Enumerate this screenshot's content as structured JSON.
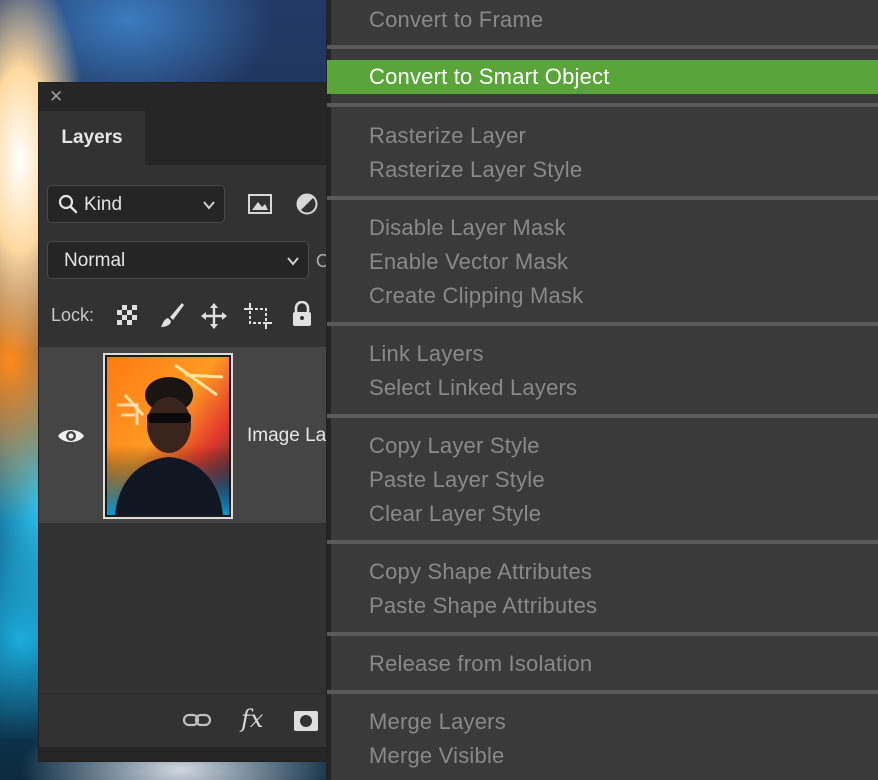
{
  "panel": {
    "close_glyph": "✕",
    "tab_label": "Layers",
    "filter": {
      "selected": "Kind",
      "icons": [
        "image-filter-icon",
        "adjustment-filter-icon"
      ]
    },
    "blend_mode": {
      "selected": "Normal"
    },
    "opacity_cut": "O",
    "lock": {
      "label": "Lock:",
      "icons": [
        "lock-transparent-pixels-icon",
        "lock-image-pixels-icon",
        "lock-position-icon",
        "lock-artboard-icon",
        "lock-all-icon"
      ]
    },
    "layers": [
      {
        "name": "Image La",
        "visible": true,
        "visibility_icon": "eye-icon"
      }
    ],
    "bottom_icons": [
      "link-layers-icon",
      "layer-style-fx-icon",
      "add-mask-icon"
    ],
    "fx_label": "fx"
  },
  "context_menu": {
    "groups": [
      {
        "items": [
          {
            "label": "Convert to Frame",
            "enabled": false
          }
        ]
      },
      {
        "items": [
          {
            "label": "Convert to Smart Object",
            "enabled": true,
            "highlighted": true
          }
        ]
      },
      {
        "items": [
          {
            "label": "Rasterize Layer",
            "enabled": false
          },
          {
            "label": "Rasterize Layer Style",
            "enabled": false
          }
        ]
      },
      {
        "items": [
          {
            "label": "Disable Layer Mask",
            "enabled": false
          },
          {
            "label": "Enable Vector Mask",
            "enabled": false
          },
          {
            "label": "Create Clipping Mask",
            "enabled": false
          }
        ]
      },
      {
        "items": [
          {
            "label": "Link Layers",
            "enabled": false
          },
          {
            "label": "Select Linked Layers",
            "enabled": false
          }
        ]
      },
      {
        "items": [
          {
            "label": "Copy Layer Style",
            "enabled": false
          },
          {
            "label": "Paste Layer Style",
            "enabled": false
          },
          {
            "label": "Clear Layer Style",
            "enabled": false
          }
        ]
      },
      {
        "items": [
          {
            "label": "Copy Shape Attributes",
            "enabled": false
          },
          {
            "label": "Paste Shape Attributes",
            "enabled": false
          }
        ]
      },
      {
        "items": [
          {
            "label": "Release from Isolation",
            "enabled": false
          }
        ]
      },
      {
        "items": [
          {
            "label": "Merge Layers",
            "enabled": false
          },
          {
            "label": "Merge Visible",
            "enabled": false
          }
        ]
      }
    ],
    "highlight_color": "#5aa53a"
  }
}
